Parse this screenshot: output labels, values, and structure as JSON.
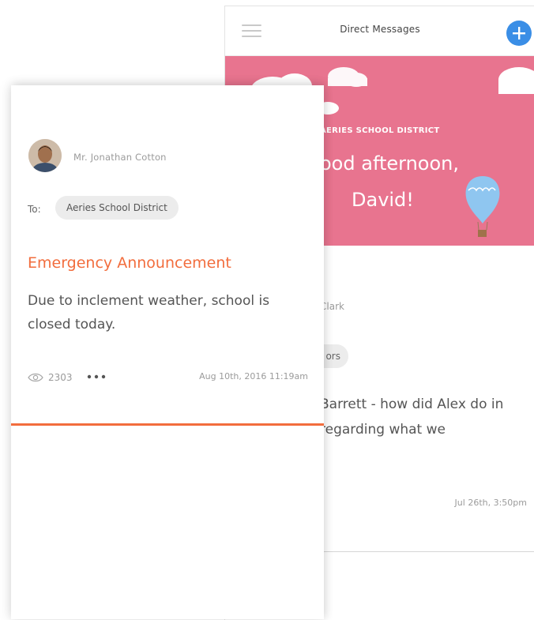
{
  "direct_messages": {
    "title": "Direct Messages",
    "menu_icon": "hamburger-menu-icon",
    "add_icon": "plus-icon",
    "banner": {
      "district": "AERIES SCHOOL DISTRICT",
      "greeting": "ood afternoon,",
      "name": "David!",
      "color": "#e8748f"
    },
    "message": {
      "sender": "Clark",
      "recipient_chip": "ors",
      "body": "Barrett - how did Alex do in regarding what we",
      "timestamp": "Jul 26th, 3:50pm"
    }
  },
  "announcement": {
    "sender": "Mr. Jonathan Cotton",
    "to_label": "To:",
    "recipient": "Aeries School District",
    "title": "Emergency Announcement",
    "body": "Due to inclement weather, school is closed today.",
    "view_icon": "eye-icon",
    "views": "2303",
    "more_icon": "more-dots-icon",
    "timestamp": "Aug 10th, 2016 11:19am",
    "accent_color": "#f26d3d"
  },
  "colors": {
    "accent_blue": "#3a8ee6",
    "accent_orange": "#f26d3d",
    "banner_pink": "#e8748f"
  }
}
